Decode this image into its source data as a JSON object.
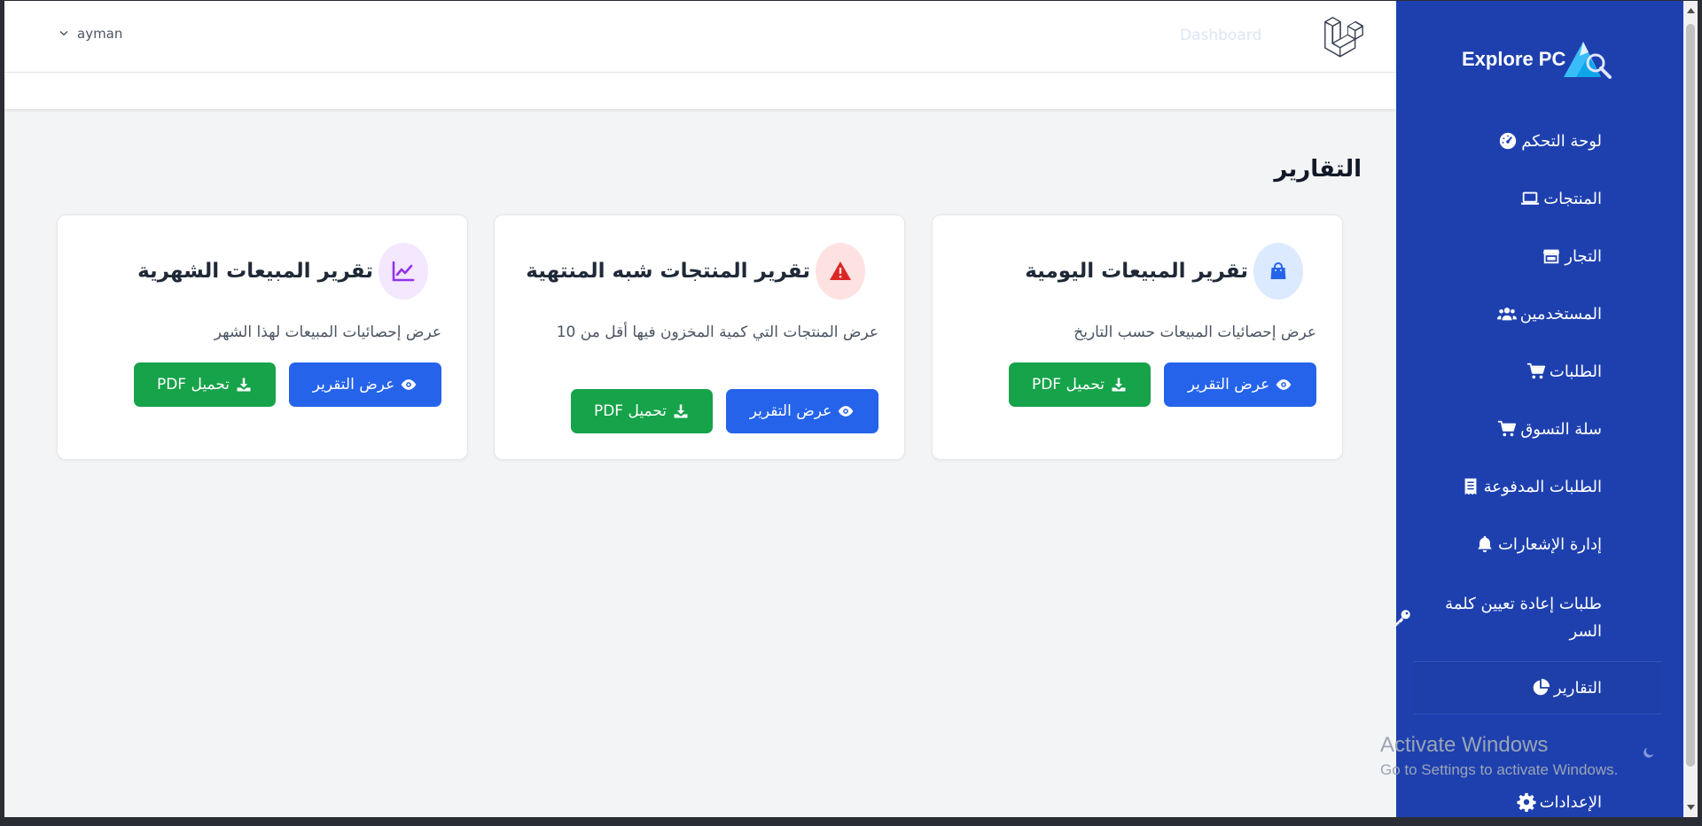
{
  "header": {
    "user_name": "ayman",
    "dashboard_link": "Dashboard"
  },
  "page": {
    "title": "التقارير"
  },
  "cards": [
    {
      "title": "تقرير المبيعات اليومية",
      "description": "عرض إحصائيات المبيعات حسب التاريخ",
      "view_label": "عرض التقرير",
      "pdf_label": "تحميل PDF",
      "icon": "shopping-bag-icon",
      "icon_color": "#2563eb",
      "icon_bg": "#dbeafe"
    },
    {
      "title": "تقرير المنتجات شبه المنتهية",
      "description": "عرض المنتجات التي كمية المخزون فيها أقل من 10",
      "view_label": "عرض التقرير",
      "pdf_label": "تحميل PDF",
      "icon": "warning-icon",
      "icon_color": "#dc2626",
      "icon_bg": "#fee2e2"
    },
    {
      "title": "تقرير المبيعات الشهرية",
      "description": "عرض إحصائيات المبيعات لهذا الشهر",
      "view_label": "عرض التقرير",
      "pdf_label": "تحميل PDF",
      "icon": "chart-line-icon",
      "icon_color": "#9333ea",
      "icon_bg": "#f3e8ff"
    }
  ],
  "sidebar": {
    "brand": "Explore PC",
    "items": [
      {
        "label": "لوحة التحكم",
        "icon": "gauge-icon"
      },
      {
        "label": "المنتجات",
        "icon": "laptop-icon"
      },
      {
        "label": "التجار",
        "icon": "store-icon"
      },
      {
        "label": "المستخدمين",
        "icon": "users-icon"
      },
      {
        "label": "الطلبات",
        "icon": "cart-icon"
      },
      {
        "label": "سلة التسوق",
        "icon": "cart-icon"
      },
      {
        "label": "الطلبات المدفوعة",
        "icon": "receipt-icon"
      },
      {
        "label": "إدارة الإشعارات",
        "icon": "bell-icon"
      },
      {
        "label": "طلبات إعادة تعيين كلمة السر",
        "icon": "key-icon"
      },
      {
        "label": "التقارير",
        "icon": "pie-chart-icon",
        "active": true
      },
      {
        "label": "الإعدادات",
        "icon": "gear-icon"
      }
    ]
  },
  "windows_watermark": {
    "line1": "Activate Windows",
    "line2": "Go to Settings to activate Windows."
  },
  "colors": {
    "sidebar_bg": "#1e40af",
    "view_button": "#2563eb",
    "pdf_button": "#16a34a"
  }
}
